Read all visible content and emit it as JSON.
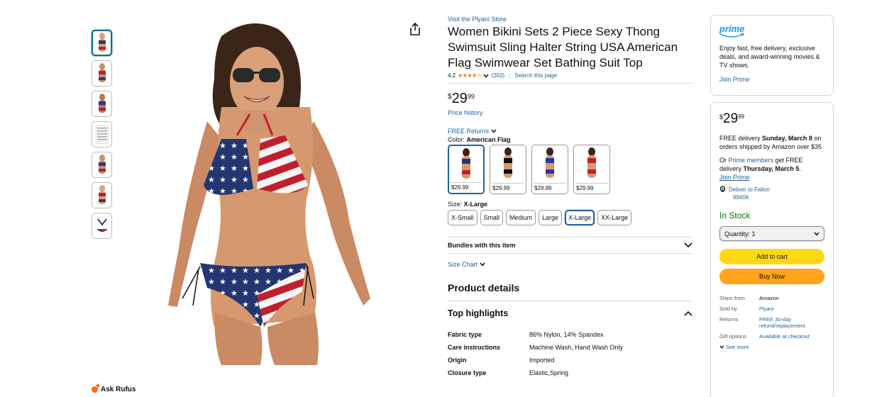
{
  "thumbnails": [
    {
      "name": "thumb-1",
      "selected": true
    },
    {
      "name": "thumb-2",
      "selected": false
    },
    {
      "name": "thumb-3",
      "selected": false
    },
    {
      "name": "thumb-4",
      "selected": false
    },
    {
      "name": "thumb-5",
      "selected": false
    },
    {
      "name": "thumb-6",
      "selected": false
    },
    {
      "name": "thumb-7",
      "selected": false
    }
  ],
  "rufus": {
    "label": "Ask Rufus"
  },
  "product": {
    "store_link": "Visit the Plyani Store",
    "title": "Women Bikini Sets 2 Piece Sexy Thong Swimsuit Sling Halter String USA American Flag Swimwear Set Bathing Suit Top",
    "rating": "4.2",
    "stars": "★★★★☆",
    "review_count": "(263)",
    "search_page": "Search this page",
    "price_symbol": "$",
    "price_whole": "29",
    "price_fraction": "99",
    "price_history": "Price history",
    "free_returns": "FREE Returns",
    "color_label": "Color:",
    "color_value": "American Flag",
    "swatches": [
      {
        "price": "$29.99",
        "selected": true
      },
      {
        "price": "$29.99",
        "selected": false
      },
      {
        "price": "$29.99",
        "selected": false
      },
      {
        "price": "$29.99",
        "selected": false
      }
    ],
    "size_label": "Size:",
    "size_value": "X-Large",
    "sizes": [
      "X-Small",
      "Small",
      "Medium",
      "Large",
      "X-Large",
      "XX-Large"
    ],
    "selected_size": "X-Large",
    "bundles": "Bundles with this item",
    "size_chart": "Size Chart",
    "product_details": "Product details",
    "top_highlights": "Top highlights",
    "details": [
      {
        "key": "Fabric type",
        "value": "86% Nylon, 14% Spandex"
      },
      {
        "key": "Care instructions",
        "value": "Machine Wash, Hand Wash Only"
      },
      {
        "key": "Origin",
        "value": "Imported"
      },
      {
        "key": "Closure type",
        "value": "Elastic,Spring"
      }
    ]
  },
  "prime": {
    "logo": "prime",
    "text": "Enjoy fast, free delivery, exclusive deals, and award-winning movies & TV shows.",
    "join": "Join Prime"
  },
  "buybox": {
    "price_symbol": "$",
    "price_whole": "29",
    "price_fraction": "99",
    "delivery_prefix": "FREE delivery",
    "delivery_date": "Sunday, March 8",
    "delivery_suffix": "on orders shipped by Amazon over $35",
    "or": "Or",
    "prime_members": "Prime members",
    "fast_prefix": "get FREE delivery",
    "fast_date": "Thursday, March 5",
    "join_prime": "Join Prime",
    "deliver_to_line1": "Deliver to Fallon",
    "deliver_to_line2": "89406",
    "stock": "In Stock",
    "quantity": "Quantity: 1",
    "add_to_cart": "Add to cart",
    "buy_now": "Buy Now",
    "ship_rows": [
      {
        "key": "Ships from",
        "value": "Amazon"
      },
      {
        "key": "Sold by",
        "value": "Plyani"
      },
      {
        "key": "Returns",
        "value": "FREE 30-day refund/replacement"
      },
      {
        "key": "Gift options",
        "value": "Available at checkout"
      }
    ],
    "see_more": "See more"
  },
  "colors": {
    "link": "#2162a1",
    "stars": "#de7921",
    "in_stock": "#007600",
    "cart": "#ffd814",
    "buy": "#ffa41c",
    "prime": "#1a98ff"
  }
}
